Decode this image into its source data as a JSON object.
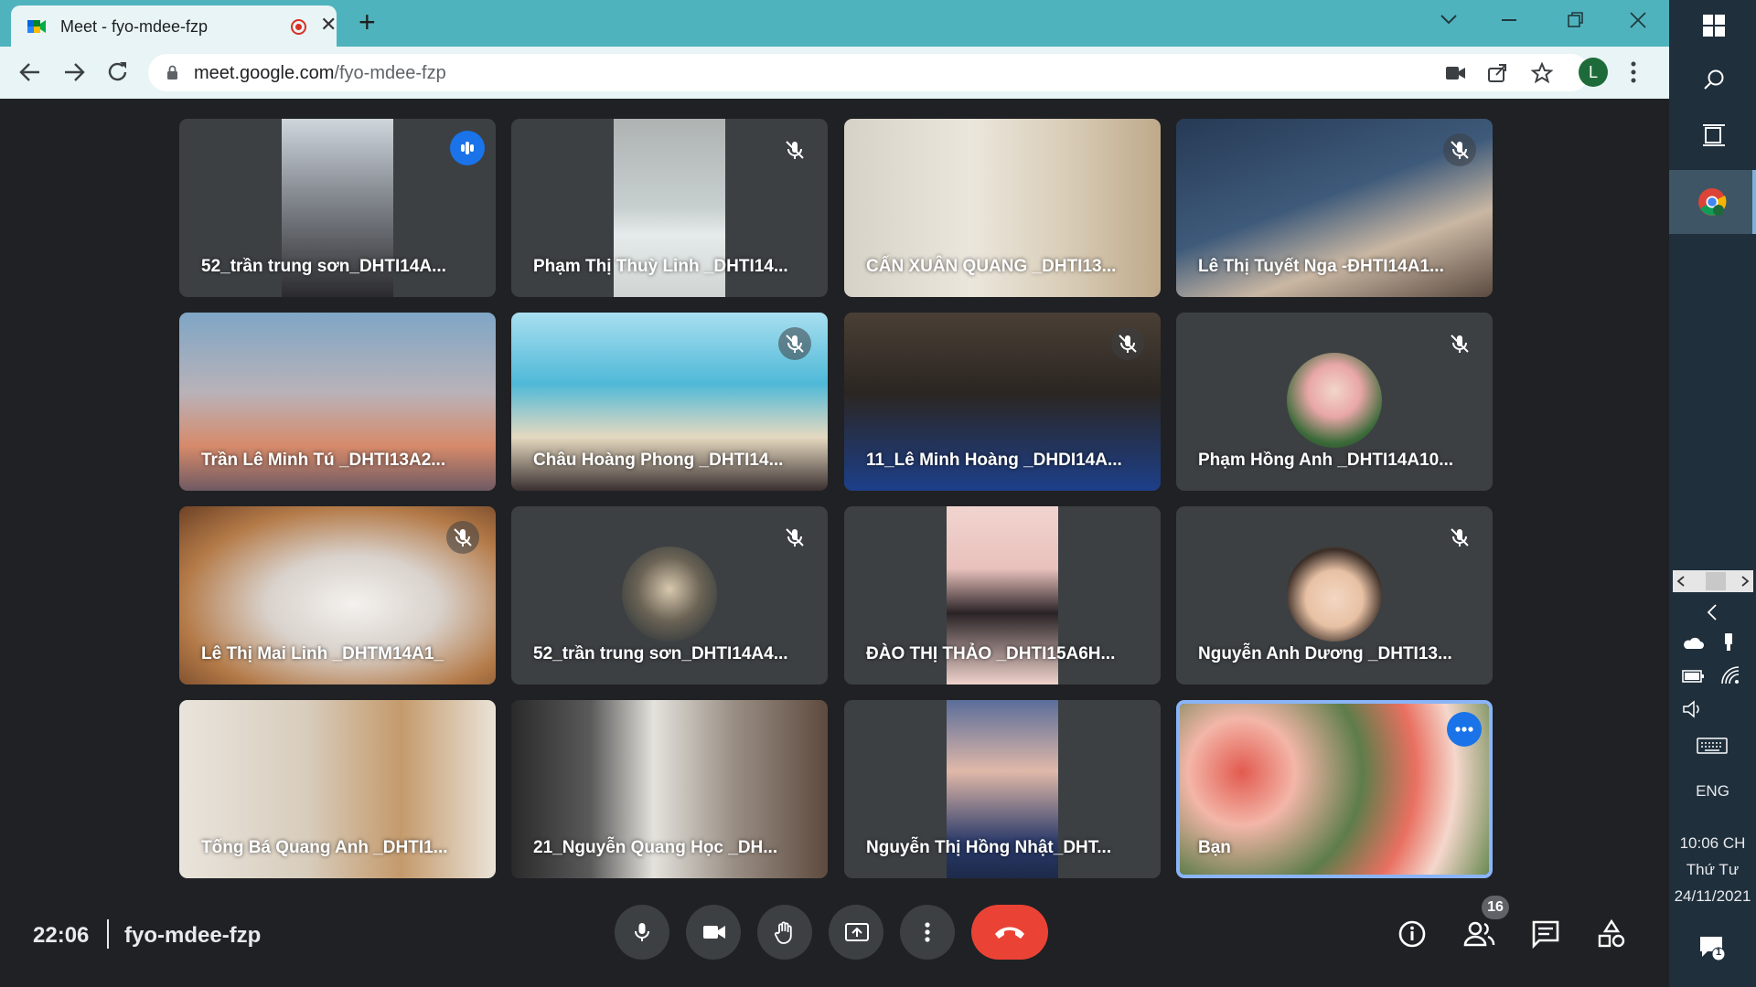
{
  "browser": {
    "tab_title": "Meet - fyo-mdee-fzp",
    "tab_close": "✕",
    "new_tab": "+",
    "url_host": "meet.google.com",
    "url_path": "/fyo-mdee-fzp",
    "profile_initial": "L"
  },
  "participants": [
    {
      "name": "52_trần trung sơn_DHTI14A...",
      "status": "speaking"
    },
    {
      "name": "Phạm Thị Thuỳ Linh _DHTI14...",
      "status": "muted"
    },
    {
      "name": "CẤN XUÂN QUANG _DHTI13...",
      "status": "none"
    },
    {
      "name": "Lê Thị Tuyết Nga -ĐHTI14A1...",
      "status": "muted"
    },
    {
      "name": "Trần Lê Minh Tú _DHTI13A2...",
      "status": "none"
    },
    {
      "name": "Châu Hoàng Phong _DHTI14...",
      "status": "muted"
    },
    {
      "name": "11_Lê Minh Hoàng _DHDI14A...",
      "status": "muted"
    },
    {
      "name": "Phạm Hồng Anh _DHTI14A10...",
      "status": "muted"
    },
    {
      "name": "Lê Thị Mai Linh _DHTM14A1_",
      "status": "muted"
    },
    {
      "name": "52_trần trung sơn_DHTI14A4...",
      "status": "muted"
    },
    {
      "name": "ĐÀO THỊ THẢO _DHTI15A6H...",
      "status": "none"
    },
    {
      "name": "Nguyễn Anh Dương _DHTI13...",
      "status": "muted"
    },
    {
      "name": "Tống Bá Quang Anh _DHTI1...",
      "status": "none"
    },
    {
      "name": "21_Nguyễn Quang Học _DH...",
      "status": "none"
    },
    {
      "name": "Nguyễn Thị Hồng Nhật_DHT...",
      "status": "none"
    },
    {
      "name": "Bạn",
      "status": "self"
    }
  ],
  "meeting": {
    "time": "22:06",
    "code": "fyo-mdee-fzp",
    "participant_count": "16"
  },
  "taskbar": {
    "language": "ENG",
    "time": "10:06 CH",
    "day": "Thứ Tư",
    "date": "24/11/2021",
    "notification_count": "1"
  },
  "colors": {
    "tabbar": "#4fb3be",
    "meet_bg": "#202124",
    "end_call": "#ea4335",
    "speaking_accent": "#1a73e8"
  }
}
